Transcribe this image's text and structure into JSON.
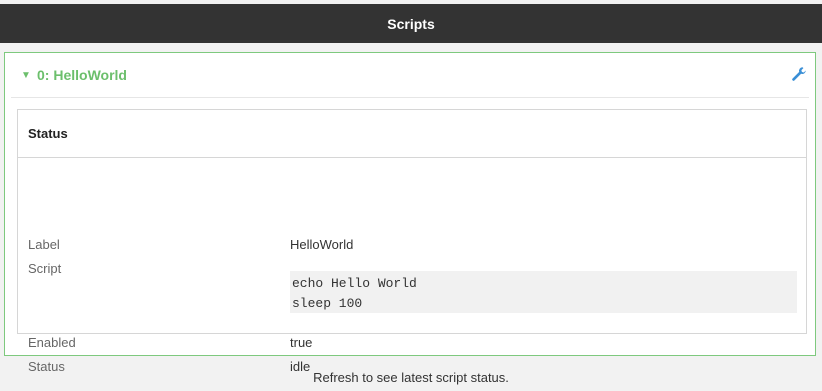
{
  "header": {
    "title": "Scripts"
  },
  "script_panel": {
    "title": "0: HelloWorld",
    "status_card": {
      "heading": "Status",
      "fields": {
        "label": {
          "name": "Label",
          "value": "HelloWorld"
        },
        "script": {
          "name": "Script",
          "lines": [
            "echo Hello World",
            "sleep 100"
          ]
        },
        "enabled": {
          "name": "Enabled",
          "value": "true"
        },
        "status": {
          "name": "Status",
          "value": "idle"
        }
      }
    }
  },
  "footer": {
    "note": "Refresh to see latest script status."
  },
  "icons": {
    "collapse": "caret-down-icon",
    "settings": "wrench-icon"
  },
  "colors": {
    "accent_green": "#6cbf6c",
    "icon_blue": "#3a8fd6",
    "header_bg": "#333333"
  }
}
